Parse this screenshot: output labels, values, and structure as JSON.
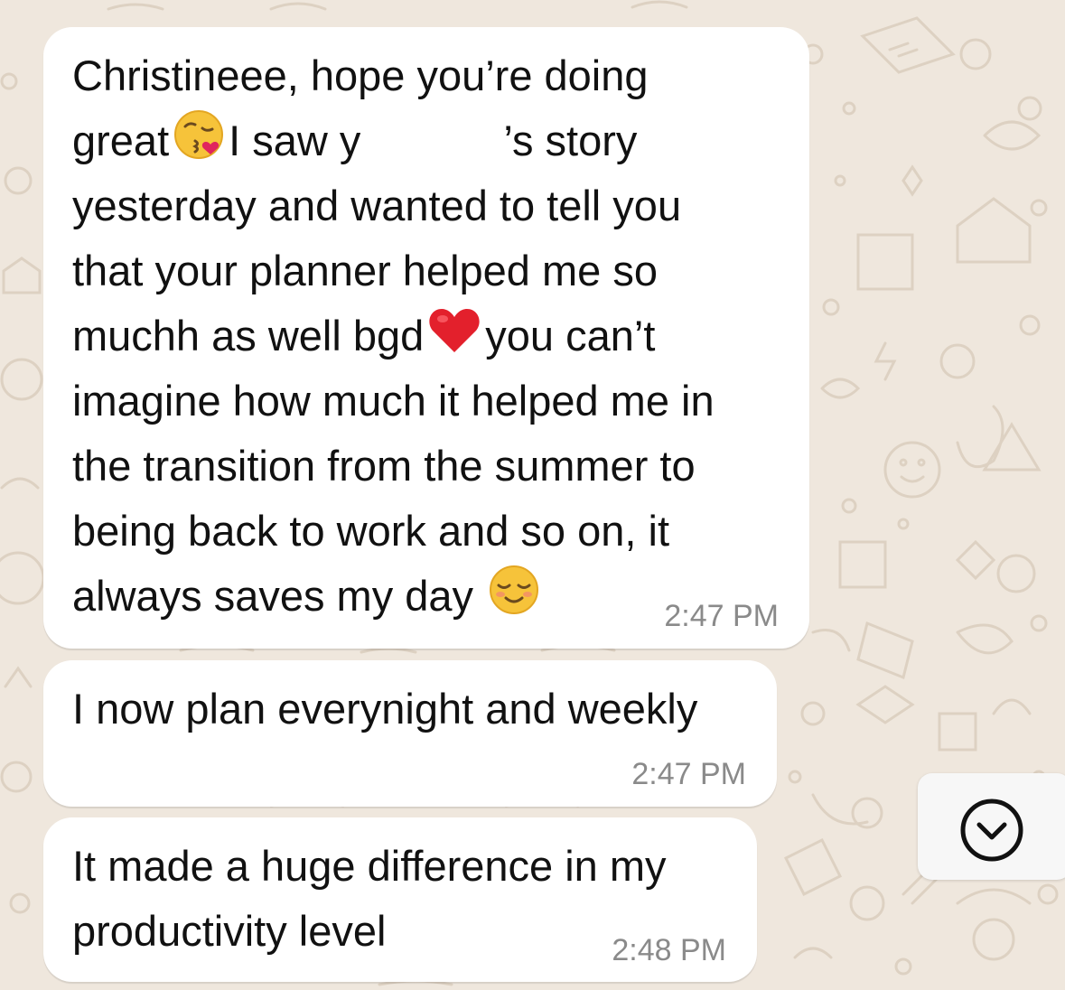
{
  "theme": {
    "chat_background": "#efe7dd",
    "bubble_color": "#ffffff",
    "text_color": "#111111",
    "time_color": "#8a8a8a"
  },
  "messages": [
    {
      "lines": [
        "Christineee, hope you’re doing",
        "great",
        "I saw y",
        "’s story",
        "yesterday and wanted to tell you",
        "that your planner helped me so",
        "muchh as well bgd",
        "you can’t",
        "imagine how much it helped me in",
        "the transition from the summer to",
        "being back to work and so on, it",
        "always saves my day"
      ],
      "emojis": [
        "kissing-heart-emoji",
        "red-heart-emoji",
        "smiling-relaxed-emoji"
      ],
      "time": "2:47 PM"
    },
    {
      "lines": [
        "I now plan everynight and weekly"
      ],
      "time": "2:47 PM"
    },
    {
      "lines": [
        "It made a huge difference in my",
        "productivity level"
      ],
      "time": "2:48 PM"
    }
  ],
  "scroll_button": {
    "icon": "chevron-down-circle-icon"
  }
}
